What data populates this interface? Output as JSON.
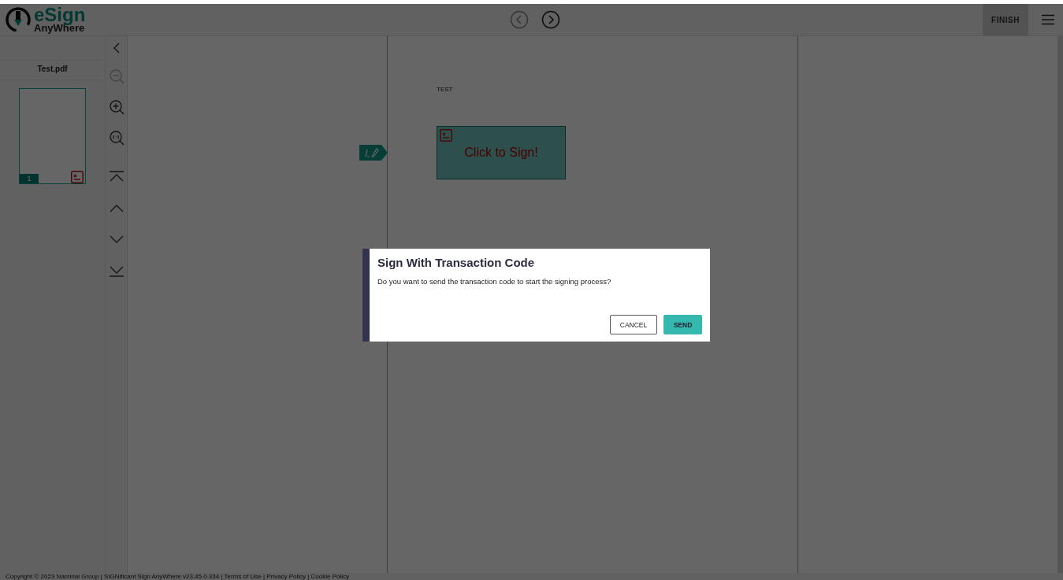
{
  "header": {
    "logo": {
      "brand": "eSign",
      "subtitle": "AnyWhere"
    },
    "nav": [
      {
        "kind": "prev",
        "disabled": true
      },
      {
        "kind": "next",
        "disabled": false
      }
    ],
    "finish": "FINISH"
  },
  "sidebar": {
    "document_tab": "Test.pdf",
    "thumbnails": [
      {
        "page": "1",
        "selected": true
      }
    ]
  },
  "tools": [
    {
      "kind": "zoom-out",
      "disabled": true
    },
    {
      "kind": "zoom-in",
      "disabled": false
    },
    {
      "kind": "zoom-reset",
      "disabled": false
    },
    {
      "kind": "first",
      "disabled": false
    },
    {
      "kind": "prev",
      "disabled": false
    },
    {
      "kind": "next",
      "disabled": false
    },
    {
      "kind": "last",
      "disabled": false
    }
  ],
  "document": {
    "text": "TEST",
    "signature_field": "Click to Sign!"
  },
  "dialog": {
    "title": "Sign With Transaction Code",
    "message": "Do you want to send the transaction code to start the signing process?",
    "buttons": [
      {
        "kind": "secondary",
        "label": "CANCEL"
      },
      {
        "kind": "primary",
        "label": "SEND"
      }
    ]
  },
  "footer": "Copyright © 2023 Namirial Group | SIGNificant Sign AnyWhere v23.45.0.334 | Terms of Use | Privacy Policy | Cookie Policy"
}
